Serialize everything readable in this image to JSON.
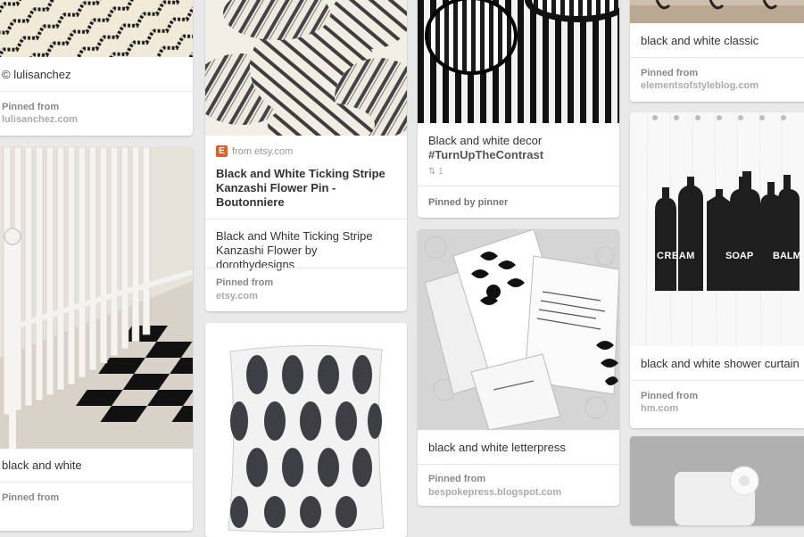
{
  "col1": {
    "card1": {
      "credit": "© lulisanchez",
      "pinned_label": "Pinned from",
      "source": "lulisanchez.com"
    },
    "card2": {
      "description": "black and white",
      "pinned_label": "Pinned from"
    }
  },
  "col2": {
    "card1": {
      "from_icon": "E",
      "from_text": "from etsy.com",
      "title": "Black and White Ticking Stripe Kanzashi Flower Pin - Boutonniere",
      "description": "Black and White Ticking Stripe Kanzashi Flower by dorothydesigns",
      "pinned_label": "Pinned from",
      "source": "etsy.com"
    }
  },
  "col3": {
    "card1": {
      "description": "Black and white decor",
      "hashtag": "#TurnUpTheContrast",
      "repin_count": "1",
      "pinned_by": "Pinned by pinner"
    },
    "card2": {
      "description": "black and white letterpress",
      "pinned_label": "Pinned from",
      "source": "bespokepress.blogspot.com"
    }
  },
  "col4": {
    "card1": {
      "description": "black and white classic",
      "pinned_label": "Pinned from",
      "source": "elementsofstyleblog.com"
    },
    "card2": {
      "description": "black and white shower curtain",
      "pinned_label": "Pinned from",
      "source": "hm.com",
      "bottle_labels": [
        "CREAM",
        "SOAP",
        "BALM"
      ]
    }
  },
  "colors": {
    "background": "#e9e9e9",
    "card": "#ffffff",
    "etsy_orange": "#d6652a"
  }
}
